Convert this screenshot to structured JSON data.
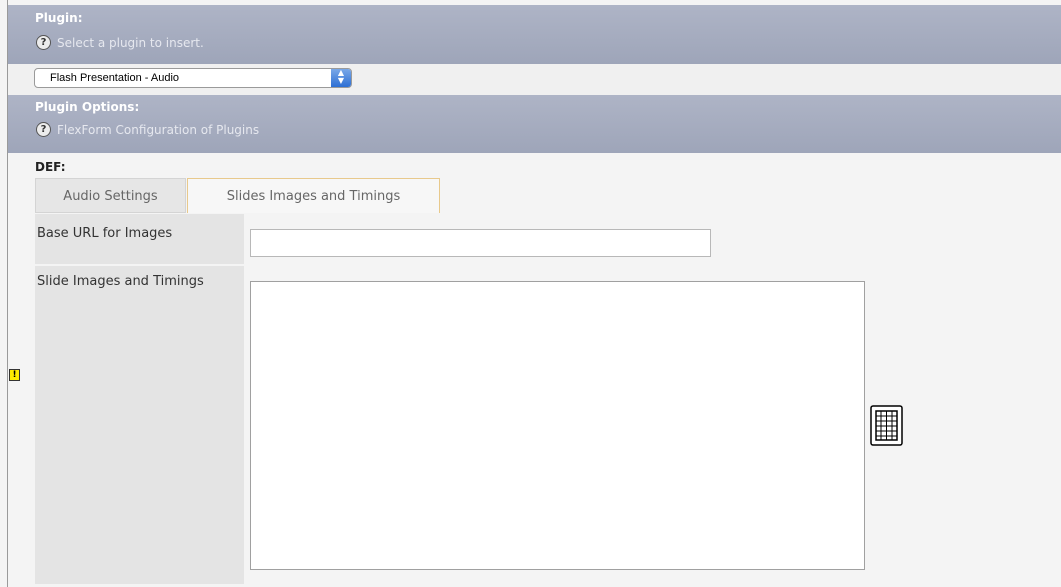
{
  "plugin_section": {
    "title": "Plugin:",
    "description": "Select a plugin to insert.",
    "help_icon": "?"
  },
  "plugin_select": {
    "selected": "Flash Presentation - Audio",
    "arrows": "▲▼"
  },
  "options_section": {
    "title": "Plugin Options:",
    "description": "FlexForm Configuration of Plugins",
    "help_icon": "?"
  },
  "sheet": {
    "label": "DEF:",
    "tabs": [
      {
        "label": "Audio Settings",
        "active": false
      },
      {
        "label": "Slides Images and Timings",
        "active": true
      }
    ]
  },
  "fields": {
    "base_url_label": "Base URL for Images",
    "base_url_value": "",
    "slides_label": "Slide Images and Timings",
    "slides_value": ""
  },
  "icons": {
    "warning": "!",
    "table_wizard": "table-wizard-icon"
  }
}
